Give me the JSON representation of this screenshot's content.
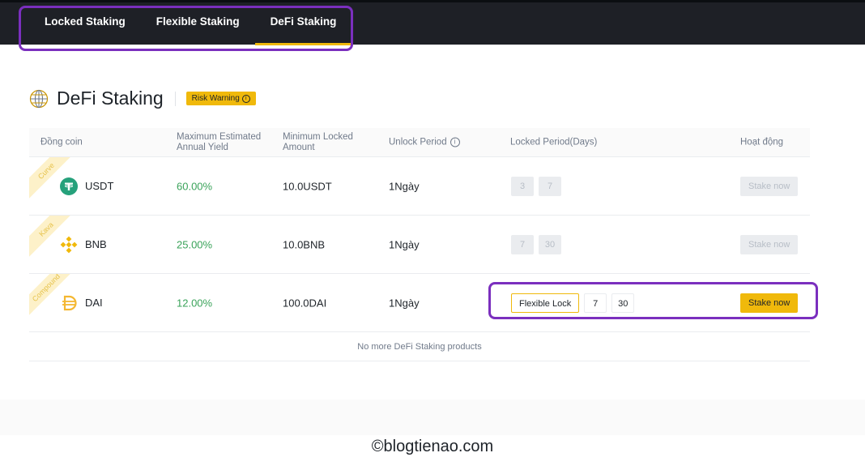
{
  "tabs": [
    {
      "label": "Locked Staking",
      "active": false
    },
    {
      "label": "Flexible Staking",
      "active": false
    },
    {
      "label": "DeFi Staking",
      "active": true
    }
  ],
  "page": {
    "title": "DeFi Staking",
    "risk_warning": "Risk Warning",
    "risk_icon": "info-icon"
  },
  "table": {
    "headers": {
      "coin": "Đồng coin",
      "yield_line1": "Maximum Estimated",
      "yield_line2": "Annual Yield",
      "min_line1": "Minimum Locked",
      "min_line2": "Amount",
      "unlock": "Unlock Period",
      "locked": "Locked Period(Days)",
      "action": "Hoạt động"
    },
    "rows": [
      {
        "protocol": "Curve",
        "coin": "USDT",
        "icon": "tether-icon",
        "yield": "60.00%",
        "min": "10.0USDT",
        "unlock": "1Ngày",
        "periods": [
          "3",
          "7"
        ],
        "stake": "Stake now"
      },
      {
        "protocol": "Kava",
        "coin": "BNB",
        "icon": "bnb-icon",
        "yield": "25.00%",
        "min": "10.0BNB",
        "unlock": "1Ngày",
        "periods": [
          "7",
          "30"
        ],
        "stake": "Stake now"
      },
      {
        "protocol": "Compound",
        "coin": "DAI",
        "icon": "dai-icon",
        "yield": "12.00%",
        "min": "100.0DAI",
        "unlock": "1Ngày",
        "flexible": "Flexible Lock",
        "periods": [
          "7",
          "30"
        ],
        "stake": "Stake now"
      }
    ],
    "no_more": "No more DeFi Staking products"
  },
  "colors": {
    "accent": "#f0b90b",
    "topbar": "#1e2026",
    "yield": "#3aa35a",
    "highlight": "#7b2fbe"
  },
  "watermark": "©blogtienao.com"
}
